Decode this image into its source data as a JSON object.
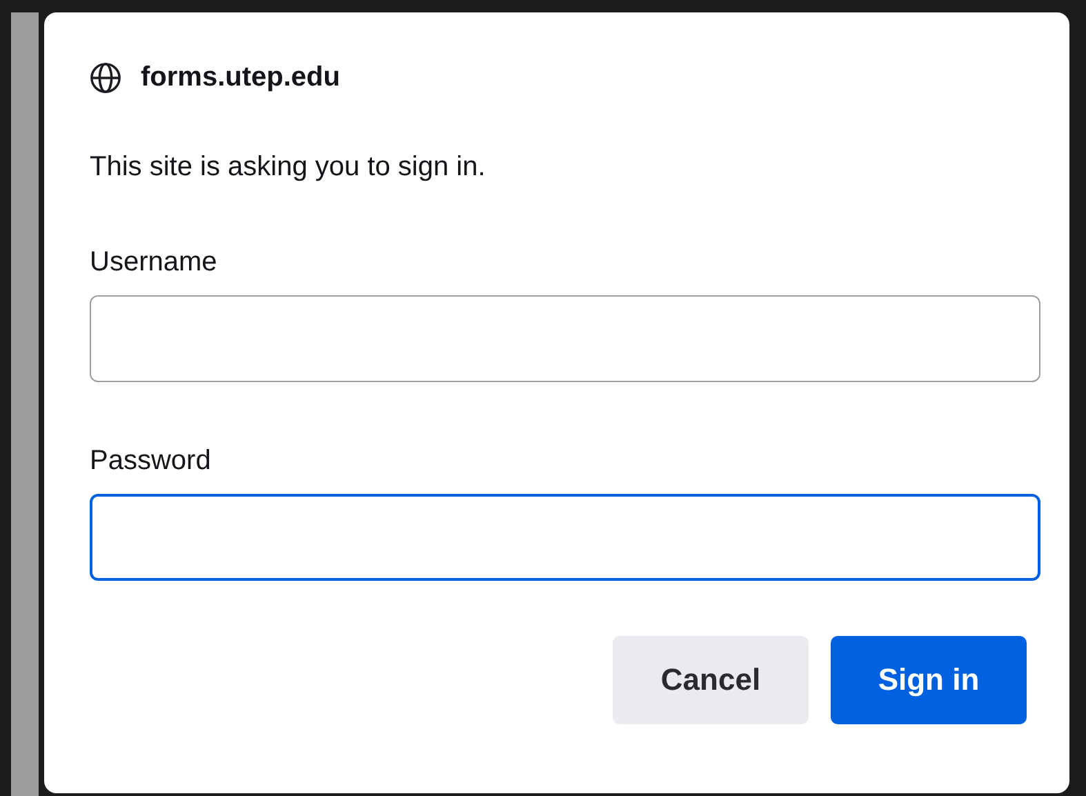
{
  "site": {
    "host": "forms.utep.edu"
  },
  "message": "This site is asking you to sign in.",
  "fields": [
    {
      "label": "Username",
      "focused": false
    },
    {
      "label": "Password",
      "focused": true
    }
  ],
  "buttons": [
    {
      "label": "Cancel",
      "kind": "secondary"
    },
    {
      "label": "Sign in",
      "kind": "primary"
    }
  ]
}
